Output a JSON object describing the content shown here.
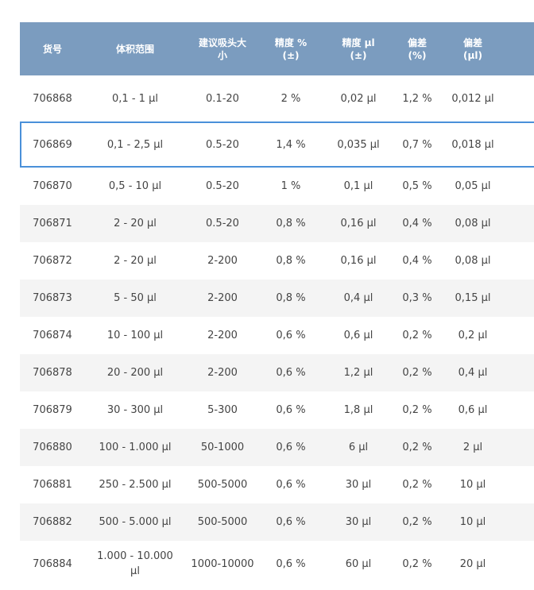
{
  "header": [
    "货号",
    "体积范围",
    "建议吸头大\n小",
    "精度 %\n(±)",
    "精度 µl\n(±)",
    "偏差\n(%)",
    "偏差\n(µl)"
  ],
  "rows": [
    [
      "706868",
      "0,1 - 1 µl",
      "0.1-20",
      "2 %",
      "0,02 µl",
      "1,2 %",
      "0,012 µl"
    ],
    [
      "706869",
      "0,1 - 2,5 µl",
      "0.5-20",
      "1,4 %",
      "0,035 µl",
      "0,7 %",
      "0,018 µl"
    ],
    [
      "706870",
      "0,5 - 10 µl",
      "0.5-20",
      "1 %",
      "0,1 µl",
      "0,5 %",
      "0,05 µl"
    ],
    [
      "706871",
      "2 - 20 µl",
      "0.5-20",
      "0,8 %",
      "0,16 µl",
      "0,4 %",
      "0,08 µl"
    ],
    [
      "706872",
      "2 - 20 µl",
      "2-200",
      "0,8 %",
      "0,16 µl",
      "0,4 %",
      "0,08 µl"
    ],
    [
      "706873",
      "5 - 50 µl",
      "2-200",
      "0,8 %",
      "0,4 µl",
      "0,3 %",
      "0,15 µl"
    ],
    [
      "706874",
      "10 - 100 µl",
      "2-200",
      "0,6 %",
      "0,6 µl",
      "0,2 %",
      "0,2 µl"
    ],
    [
      "706878",
      "20 - 200 µl",
      "2-200",
      "0,6 %",
      "1,2 µl",
      "0,2 %",
      "0,4 µl"
    ],
    [
      "706879",
      "30 - 300 µl",
      "5-300",
      "0,6 %",
      "1,8 µl",
      "0,2 %",
      "0,6 µl"
    ],
    [
      "706880",
      "100 - 1.000 µl",
      "50-1000",
      "0,6 %",
      "6 µl",
      "0,2 %",
      "2 µl"
    ],
    [
      "706881",
      "250 - 2.500 µl",
      "500-5000",
      "0,6 %",
      "30 µl",
      "0,2 %",
      "10 µl"
    ],
    [
      "706882",
      "500 - 5.000 µl",
      "500-5000",
      "0,6 %",
      "30 µl",
      "0,2 %",
      "10 µl"
    ],
    [
      "706884",
      "1.000 - 10.000 µl",
      "1000-10000",
      "0,6 %",
      "60 µl",
      "0,2 %",
      "20 µl"
    ]
  ],
  "selected_row": 1
}
